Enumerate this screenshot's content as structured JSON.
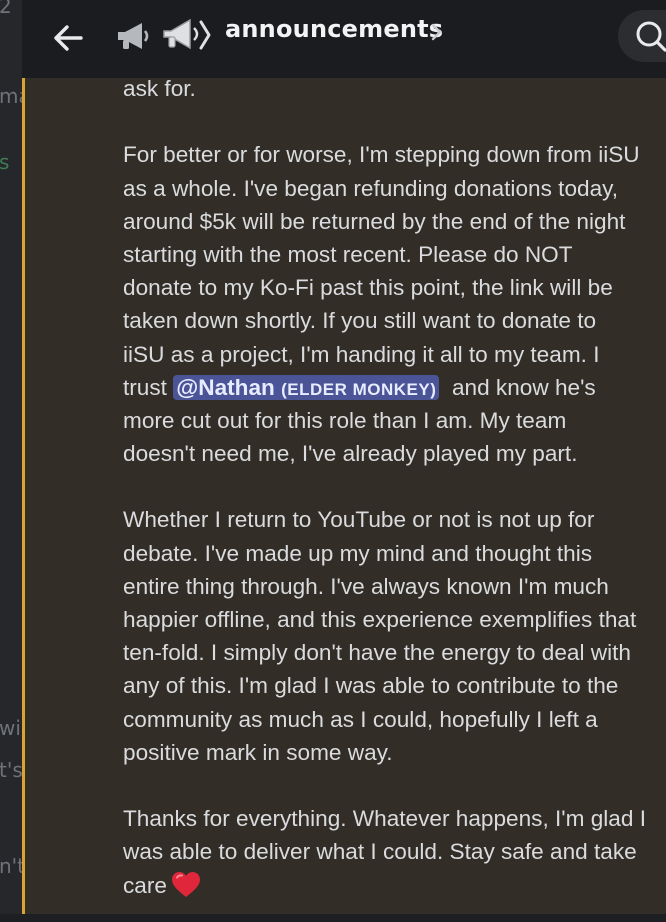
{
  "header": {
    "back_icon": "arrow-left-icon",
    "channel_icon": "megaphone-icon",
    "channel_name": "announcements",
    "chevron": "›",
    "search_icon": "search-icon"
  },
  "left_edge_fragments": [
    "2",
    "ma",
    "s",
    "wi",
    "t's",
    "n't"
  ],
  "message": {
    "para0_lines": [
      "ask for."
    ],
    "para1_lines": [
      "For better or for worse, I'm stepping down from iiSU",
      "as a whole. I've began refunding donations today,",
      "around $5k will be returned by the end of the night",
      "starting with the most recent. Please do NOT",
      "donate to my Ko-Fi past this point, the link will be",
      "taken down shortly. If you still want to donate to",
      "iiSU as a project, I'm handing it all to my team. I"
    ],
    "mention_prefix": "trust ",
    "mention_name": "@Nathan",
    "mention_role": "(ELDER MONKEY)",
    "mention_suffix": "  and know he's",
    "para1_tail_lines": [
      "more cut out for this role than I am. My team",
      "doesn't need me, I've already played my part."
    ],
    "para2_lines": [
      "Whether I return to YouTube or not is not up for",
      "debate. I've made up my mind and thought this",
      "entire thing through. I've always known I'm much",
      "happier offline, and this experience exemplifies that",
      "ten-fold. I simply don't have the energy to deal with",
      "any of this. I'm glad I was able to contribute to the",
      "community as much as I could, hopefully I left a",
      "positive mark in some way."
    ],
    "para3_lines": [
      "Thanks for everything. Whatever happens, I'm glad I",
      "was able to deliver what I could. Stay safe and take"
    ],
    "closing": "care",
    "closing_emoji": "red-heart-icon"
  },
  "colors": {
    "mention_highlight_bar": "#d8a533",
    "mention_bg": "#4b5496",
    "message_bg": "#322e27"
  }
}
